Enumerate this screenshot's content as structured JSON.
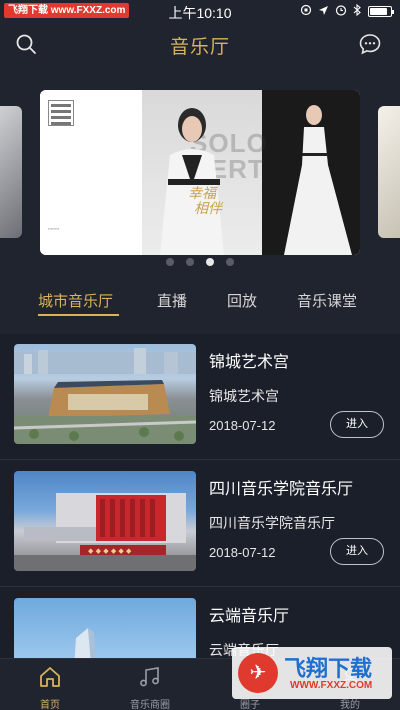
{
  "status_bar": {
    "watermark": "飞翔下载 www.FXXZ.com",
    "time": "上午10:10"
  },
  "header": {
    "title": "音乐厅",
    "search_icon": "search-icon",
    "message_icon": "chat-bubble-icon"
  },
  "banner": {
    "gold_text_line1": "幸福",
    "gold_text_line2": "相伴",
    "big_text": "SOLO\nCERT",
    "slide_count": 4,
    "active_slide": 3
  },
  "tabs": [
    {
      "label": "城市音乐厅",
      "active": true
    },
    {
      "label": "直播",
      "active": false
    },
    {
      "label": "回放",
      "active": false
    },
    {
      "label": "音乐课堂",
      "active": false
    }
  ],
  "venues": [
    {
      "name": "锦城艺术宫",
      "subtitle": "锦城艺术宫",
      "date": "2018-07-12",
      "button": "进入"
    },
    {
      "name": "四川音乐学院音乐厅",
      "subtitle": "四川音乐学院音乐厅",
      "date": "2018-07-12",
      "button": "进入"
    },
    {
      "name": "云端音乐厅",
      "subtitle": "云端音乐厅",
      "date": "",
      "button": ""
    }
  ],
  "bottom_nav": [
    {
      "label": "首页",
      "icon": "home-icon",
      "active": true
    },
    {
      "label": "音乐商圈",
      "icon": "music-note-icon",
      "active": false
    },
    {
      "label": "圈子",
      "icon": "circle-icon",
      "active": false
    },
    {
      "label": "我的",
      "icon": "user-icon",
      "active": false
    }
  ],
  "watermark_logo": {
    "title": "飞翔下载",
    "url": "WWW.FXXZ.COM"
  },
  "colors": {
    "accent": "#d9b25c",
    "background": "#1b1f2a",
    "header_bg": "#20242f"
  }
}
